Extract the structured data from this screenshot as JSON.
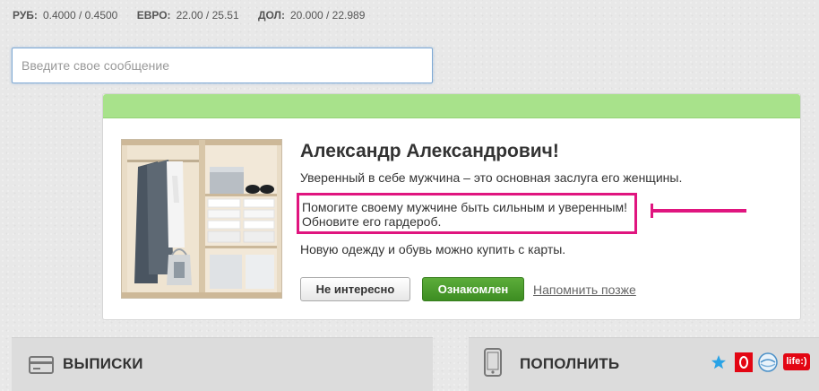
{
  "rates": [
    {
      "label": "РУБ:",
      "value": "0.4000 / 0.4500"
    },
    {
      "label": "ЕВРО:",
      "value": "22.00 / 25.51"
    },
    {
      "label": "ДОЛ:",
      "value": "20.000 / 22.989"
    }
  ],
  "message": {
    "placeholder": "Введите свое сообщение",
    "value": ""
  },
  "offer": {
    "title": "Александр Александрович!",
    "line1": "Уверенный в себе мужчина – это основная заслуга его женщины.",
    "highlight_line1": "Помогите своему мужчине быть сильным и уверенным!",
    "highlight_line2": "Обновите его гардероб.",
    "line4": "Новую одежду и обувь можно купить с карты.",
    "buttons": {
      "not_interested": "Не интересно",
      "acknowledged": "Ознакомлен",
      "remind_later": "Напомнить позже"
    },
    "colors": {
      "header": "#a8e28b",
      "highlight_border": "#e0157f",
      "accept_button": "#4a9b2d"
    }
  },
  "panels": {
    "statements": {
      "label": "ВЫПИСКИ",
      "icon": "card-icon"
    },
    "topup": {
      "label": "ПОПОЛНИТЬ",
      "icon": "phone-icon"
    }
  },
  "operators": [
    {
      "name": "star-icon"
    },
    {
      "name": "mts-logo"
    },
    {
      "name": "intertelecom-logo"
    },
    {
      "name": "life-logo",
      "text": "life:)"
    }
  ]
}
